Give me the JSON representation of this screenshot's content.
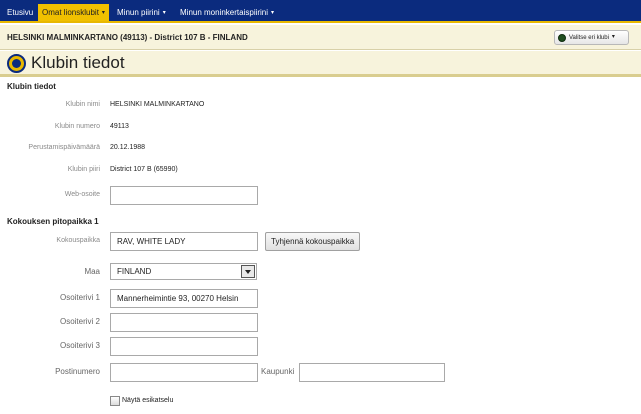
{
  "nav": {
    "items": [
      {
        "label": "Etusivu",
        "has_caret": false
      },
      {
        "label": "Omat lionsklubit",
        "has_caret": true
      },
      {
        "label": "Minun piirini",
        "has_caret": true
      },
      {
        "label": "Minun moninkertaispiirini",
        "has_caret": true
      }
    ],
    "caret": "▾"
  },
  "club_bar": {
    "title": "HELSINKI MALMINKARTANO (49113) - District 107 B - FINLAND",
    "select_label": "Valitse eri klubi"
  },
  "page": {
    "title": "Klubin tiedot"
  },
  "club_info": {
    "section_title": "Klubin tiedot",
    "club_name_label": "Klubin nimi",
    "club_name": "HELSINKI MALMINKARTANO",
    "club_number_label": "Klubin numero",
    "club_number": "49113",
    "founded_label": "Perustamispäivämäärä",
    "founded": "20.12.1988",
    "district_label": "Klubin piiri",
    "district": "District 107 B (65990)",
    "website_label": "Web-osoite",
    "website": ""
  },
  "meeting": {
    "section_title": "Kokouksen pitopaikka 1",
    "place_label": "Kokouspaikka",
    "place": "RAV, WHITE LADY",
    "clear_button": "Tyhjennä kokouspaikka",
    "country_label": "Maa",
    "country": "FINLAND",
    "address1_label": "Osoiterivi 1",
    "address1": "Mannerheimintie 93, 00270 Helsin",
    "address2_label": "Osoiterivi 2",
    "address2": "",
    "address3_label": "Osoiterivi 3",
    "address3": "",
    "postal_label": "Postinumero",
    "postal": "",
    "city_label": "Kaupunki",
    "city": "",
    "preview_label": "Näytä esikatselu",
    "preview_checked": false
  },
  "colors": {
    "nav_bg": "#0b2b7e",
    "accent": "#f0c000",
    "header_bg": "#f7f3dc"
  }
}
